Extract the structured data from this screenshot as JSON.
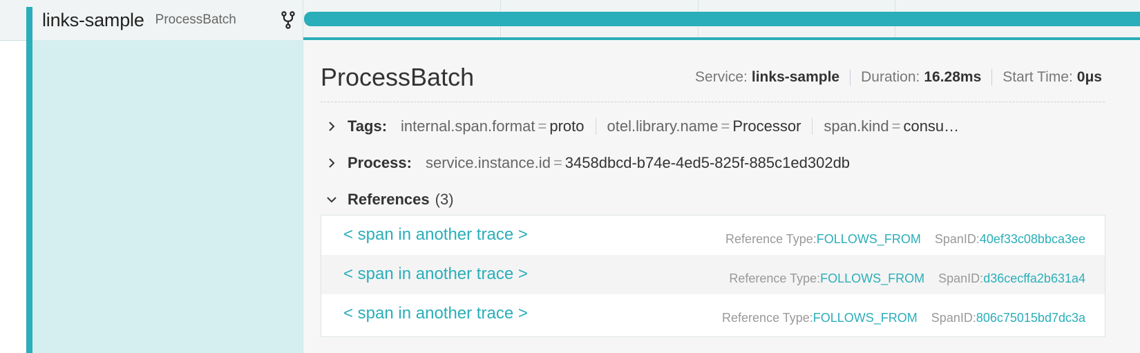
{
  "span": {
    "service": "links-sample",
    "operation": "ProcessBatch"
  },
  "icons": {
    "fork": "fork-icon",
    "chevron_right": "chevron-right-icon",
    "chevron_down": "chevron-down-icon"
  },
  "colors": {
    "accent": "#2aaeb9",
    "left_panel": "#d5eff1",
    "detail_bg": "#f6f6f6"
  },
  "detail": {
    "title": "ProcessBatch",
    "service_label": "Service:",
    "service_value": "links-sample",
    "duration_label": "Duration:",
    "duration_value": "16.28ms",
    "start_label": "Start Time:",
    "start_value": "0μs",
    "tags": {
      "label": "Tags:",
      "items": [
        {
          "key": "internal.span.format",
          "value": "proto"
        },
        {
          "key": "otel.library.name",
          "value": "Processor"
        },
        {
          "key": "span.kind",
          "value": "consu…"
        }
      ]
    },
    "process": {
      "label": "Process:",
      "items": [
        {
          "key": "service.instance.id",
          "value": "3458dbcd-b74e-4ed5-825f-885c1ed302db"
        }
      ]
    },
    "references": {
      "label": "References",
      "count": "(3)",
      "items": [
        {
          "link": "< span in another trace >",
          "type_label": "Reference Type:",
          "type": "FOLLOWS_FROM",
          "span_label": "SpanID:",
          "span_id": "40ef33c08bbca3ee"
        },
        {
          "link": "< span in another trace >",
          "type_label": "Reference Type:",
          "type": "FOLLOWS_FROM",
          "span_label": "SpanID:",
          "span_id": "d36cecffa2b631a4"
        },
        {
          "link": "< span in another trace >",
          "type_label": "Reference Type:",
          "type": "FOLLOWS_FROM",
          "span_label": "SpanID:",
          "span_id": "806c75015bd7dc3a"
        }
      ]
    }
  }
}
